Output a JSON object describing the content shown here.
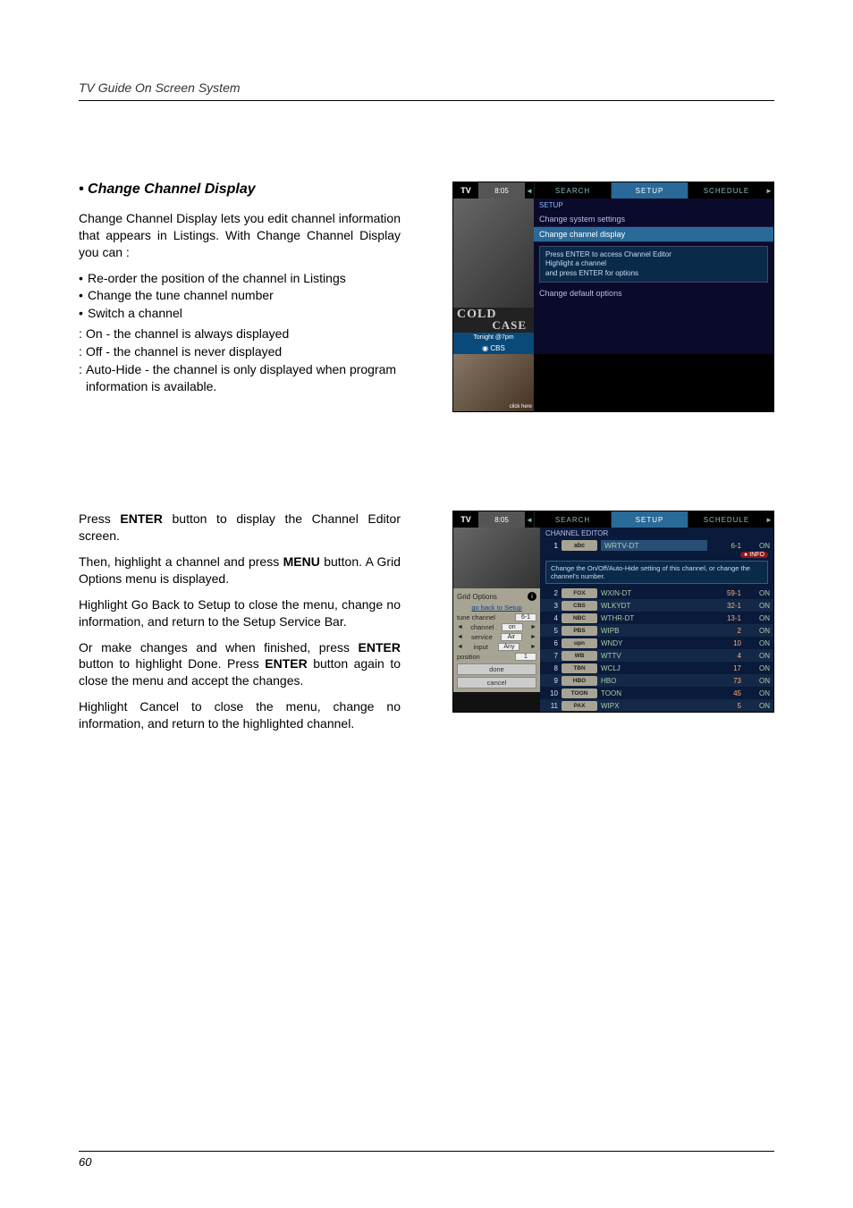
{
  "header": {
    "title": "TV Guide On Screen System"
  },
  "s1": {
    "subhead": "• Change Channel Display",
    "intro": "Change Channel Display lets you edit channel information that appears in Listings. With Change Channel Display you can :",
    "bullets": [
      "Re-order the position of the channel in Listings",
      "Change the tune channel number",
      "Switch a channel"
    ],
    "opts": [
      "On - the channel is always displayed",
      "Off - the channel is never displayed",
      "Auto-Hide - the channel is only displayed when  program information is available."
    ],
    "shot": {
      "logo": "TV",
      "time": "8:05",
      "tabs": {
        "search": "SEARCH",
        "setup": "SETUP",
        "schedule": "SCHEDULE"
      },
      "setup_label": "SETUP",
      "item1": "Change system settings",
      "item2": "Change channel display",
      "help1": "Press ENTER to access Channel Editor",
      "help2": "Highlight a channel",
      "help3": "and press ENTER for options",
      "item3": "Change default options",
      "cold": "COLD",
      "case": "CASE",
      "tonight": "Tonight @7pm",
      "cbs": "CBS",
      "click": "click\nhere"
    }
  },
  "s2": {
    "p1a": "Press ",
    "p1b": "ENTER",
    "p1c": " button to display the Channel Editor screen.",
    "p2a": "Then, highlight a channel and press ",
    "p2b": "MENU",
    "p2c": " button. A Grid Options menu is displayed.",
    "p3": "Highlight Go Back to Setup to close the menu, change no information, and return to the Setup Service Bar.",
    "p4a": "Or make changes and when finished, press ",
    "p4b": "ENTER",
    "p4c": " button to highlight Done. Press ",
    "p4d": "ENTER",
    "p4e": " button again to close the menu and accept the changes.",
    "p5": "Highlight Cancel to close the menu, change no information, and return to the highlighted channel.",
    "shot": {
      "logo": "TV",
      "time": "8:05",
      "tabs": {
        "search": "SEARCH",
        "setup": "SETUP",
        "schedule": "SCHEDULE"
      },
      "ce_title": "CHANNEL EDITOR",
      "info_badge": "INFO",
      "panel": {
        "head": "Grid Options",
        "goback": "go back to Setup",
        "tune_l": "tune channel",
        "tune_v": "6-1",
        "chan_l": "channel",
        "chan_v": "on",
        "serv_l": "service",
        "serv_v": "Air",
        "input_l": "input",
        "input_v": "Any",
        "pos_l": "position",
        "pos_v": "1",
        "done": "done",
        "cancel": "cancel"
      },
      "help": "Change the On/Off/Auto-Hide setting of this channel, or change the channel's number.",
      "sel": {
        "n": "1",
        "net": "abc",
        "name": "WRTV-DT",
        "ch": "6-1",
        "on": "ON"
      },
      "rows": [
        {
          "n": "2",
          "net": "FOX",
          "name": "WXIN-DT",
          "ch": "59-1",
          "on": "ON"
        },
        {
          "n": "3",
          "net": "CBS",
          "name": "WLKYDT",
          "ch": "32-1",
          "on": "ON"
        },
        {
          "n": "4",
          "net": "NBC",
          "name": "WTHR-DT",
          "ch": "13-1",
          "on": "ON"
        },
        {
          "n": "5",
          "net": "PBS",
          "name": "WIPB",
          "ch": "2",
          "on": "ON"
        },
        {
          "n": "6",
          "net": "upn",
          "name": "WNDY",
          "ch": "10",
          "on": "ON"
        },
        {
          "n": "7",
          "net": "WB",
          "name": "WTTV",
          "ch": "4",
          "on": "ON"
        },
        {
          "n": "8",
          "net": "TBN",
          "name": "WCLJ",
          "ch": "17",
          "on": "ON"
        },
        {
          "n": "9",
          "net": "HBO",
          "name": "HBO",
          "ch": "73",
          "on": "ON"
        },
        {
          "n": "10",
          "net": "TOON",
          "name": "TOON",
          "ch": "45",
          "on": "ON"
        },
        {
          "n": "11",
          "net": "PAX",
          "name": "WIPX",
          "ch": "5",
          "on": "ON"
        }
      ]
    }
  },
  "footer": {
    "page": "60"
  }
}
